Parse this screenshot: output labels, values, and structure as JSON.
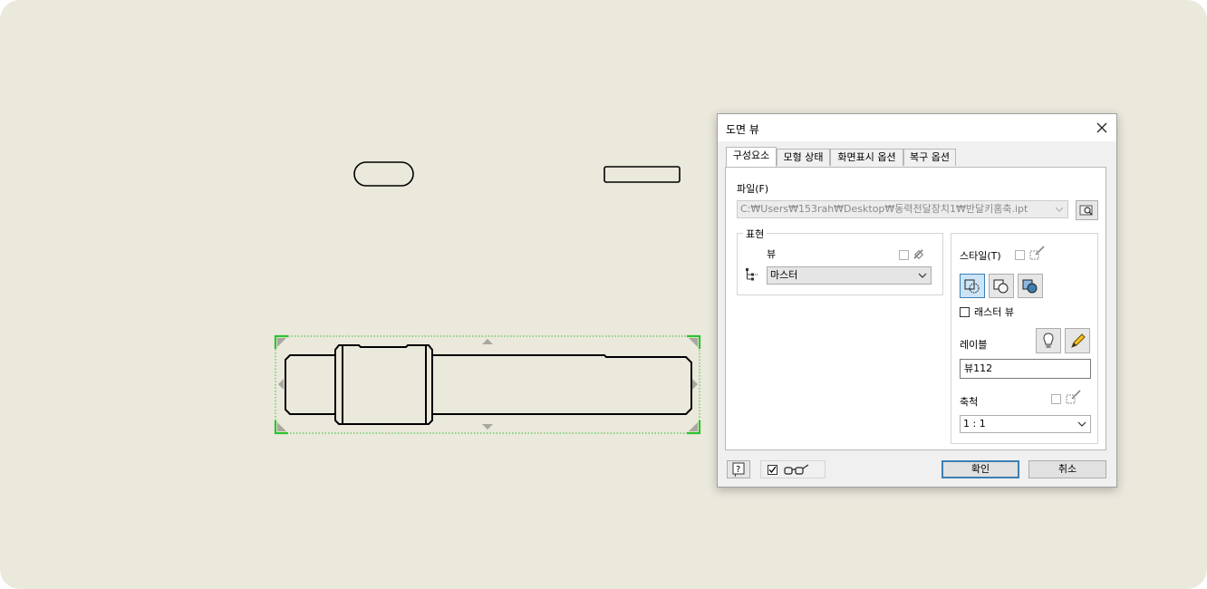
{
  "dialog": {
    "title": "도면 뷰",
    "tabs": [
      {
        "label": "구성요소",
        "active": true
      },
      {
        "label": "모형 상태",
        "active": false
      },
      {
        "label": "화면표시 옵션",
        "active": false
      },
      {
        "label": "복구 옵션",
        "active": false
      }
    ],
    "file": {
      "label": "파일(F)",
      "value": "C:₩Users₩153rah₩Desktop₩동력전달장치1₩반달키홈축.ipt"
    },
    "representation": {
      "group_label": "표현",
      "view_label": "뷰",
      "view_value": "마스터"
    },
    "style": {
      "label": "스타일(T)",
      "raster_label": "래스터 뷰",
      "raster_checked": false
    },
    "label_section": {
      "label": "레이블",
      "value": "뷰112"
    },
    "scale": {
      "label": "축척",
      "value": "1 : 1"
    },
    "footer": {
      "preview_checked": true,
      "ok_label": "확인",
      "cancel_label": "취소"
    }
  },
  "colors": {
    "canvas_bg": "#ebe8dc",
    "selection_green": "#2ec12e",
    "accent_blue": "#3c7fb1"
  }
}
